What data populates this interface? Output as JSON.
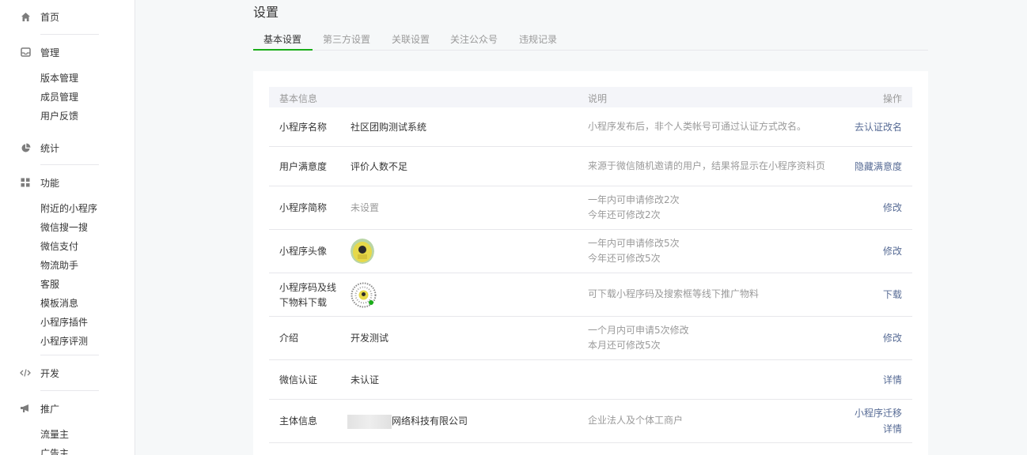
{
  "sidebar": {
    "home": "首页",
    "manage": "管理",
    "manage_items": [
      "版本管理",
      "成员管理",
      "用户反馈"
    ],
    "stats": "统计",
    "features": "功能",
    "feature_items": [
      "附近的小程序",
      "微信搜一搜",
      "微信支付",
      "物流助手",
      "客服",
      "模板消息",
      "小程序插件",
      "小程序评测"
    ],
    "develop": "开发",
    "promote": "推广",
    "promote_items": [
      "流量主",
      "广告主"
    ]
  },
  "page": {
    "title": "设置",
    "tabs": [
      "基本设置",
      "第三方设置",
      "关联设置",
      "关注公众号",
      "违规记录"
    ]
  },
  "table": {
    "headers": {
      "info": "基本信息",
      "desc": "说明",
      "op": "操作"
    },
    "rows": [
      {
        "label": "小程序名称",
        "value": "社区团购测试系统",
        "desc": [
          "小程序发布后，非个人类帐号可通过认证方式改名。"
        ],
        "ops": [
          "去认证改名"
        ]
      },
      {
        "label": "用户满意度",
        "value": "评价人数不足",
        "desc": [
          "来源于微信随机邀请的用户，结果将显示在小程序资料页"
        ],
        "ops": [
          "隐藏满意度"
        ]
      },
      {
        "label": "小程序简称",
        "value": "未设置",
        "desc": [
          "一年内可申请修改2次",
          "今年还可修改2次"
        ],
        "ops": [
          "修改"
        ]
      },
      {
        "label": "小程序头像",
        "value": "",
        "desc": [
          "一年内可申请修改5次",
          "今年还可修改5次"
        ],
        "ops": [
          "修改"
        ]
      },
      {
        "label": [
          "小程序码及线",
          "下物料下载"
        ],
        "value": "",
        "desc": [
          "可下载小程序码及搜索框等线下推广物料"
        ],
        "ops": [
          "下载"
        ]
      },
      {
        "label": "介绍",
        "value": "开发测试",
        "desc": [
          "一个月内可申请5次修改",
          "本月还可修改5次"
        ],
        "ops": [
          "修改"
        ]
      },
      {
        "label": "微信认证",
        "value": "未认证",
        "desc": [],
        "ops": [
          "详情"
        ]
      },
      {
        "label": "主体信息",
        "value": "网络科技有限公司",
        "desc": [
          "企业法人及个体工商户"
        ],
        "ops": [
          "小程序迁移",
          "详情"
        ]
      }
    ]
  },
  "colors": {
    "accent": "#1aad19",
    "link": "#576b95"
  }
}
